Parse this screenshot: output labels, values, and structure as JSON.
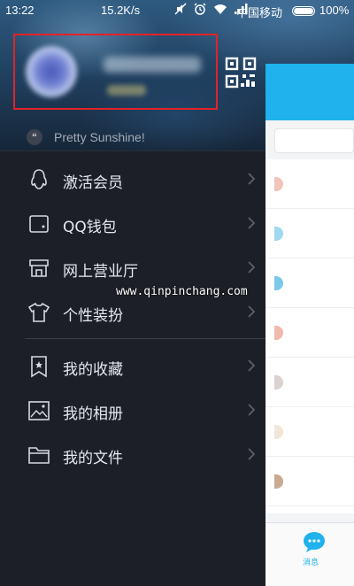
{
  "status_bar": {
    "time": "13:22",
    "network_speed": "15.2K/s",
    "carrier": "中国移动",
    "battery": "100%"
  },
  "profile": {
    "highlight_color": "#e0242a"
  },
  "signature": {
    "quote_glyph": "“",
    "text": "Pretty Sunshine!"
  },
  "menu": {
    "items": [
      {
        "label": "激活会员",
        "icon": "penguin-icon"
      },
      {
        "label": "QQ钱包",
        "icon": "wallet-icon"
      },
      {
        "label": "网上营业厅",
        "icon": "store-icon"
      },
      {
        "label": "个性装扮",
        "icon": "tshirt-icon"
      },
      {
        "label": "我的收藏",
        "icon": "bookmark-star-icon"
      },
      {
        "label": "我的相册",
        "icon": "photo-icon"
      },
      {
        "label": "我的文件",
        "icon": "folder-icon"
      }
    ]
  },
  "peek_panel": {
    "accent": "#1fb2ec",
    "tab_label": "消息"
  },
  "watermark": "www.qinpinchang.com"
}
